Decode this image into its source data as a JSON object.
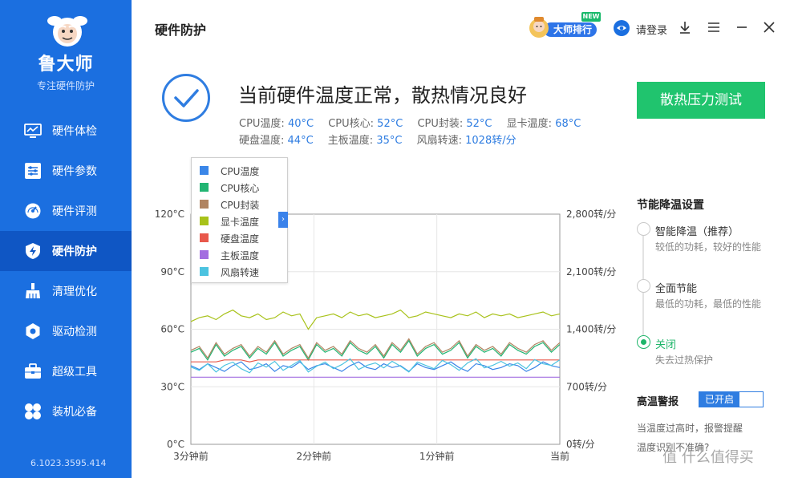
{
  "app": {
    "name": "鲁大师",
    "tagline": "专注硬件防护",
    "version": "6.1023.3595.414"
  },
  "sidebar": {
    "items": [
      {
        "label": "硬件体检",
        "icon": "monitor-icon"
      },
      {
        "label": "硬件参数",
        "icon": "sliders-icon"
      },
      {
        "label": "硬件评测",
        "icon": "speedometer-icon"
      },
      {
        "label": "硬件防护",
        "icon": "shield-bolt-icon",
        "active": true
      },
      {
        "label": "清理优化",
        "icon": "broom-icon"
      },
      {
        "label": "驱动检测",
        "icon": "gear-icon"
      },
      {
        "label": "超级工具",
        "icon": "toolbox-icon"
      },
      {
        "label": "装机必备",
        "icon": "apps-icon"
      }
    ]
  },
  "header": {
    "title": "硬件防护",
    "master_label": "大师排行",
    "new_badge": "NEW",
    "login_label": "请登录"
  },
  "status": {
    "headline": "当前硬件温度正常，散热情况良好",
    "row1": [
      {
        "label": "CPU温度:",
        "value": "40°C"
      },
      {
        "label": "CPU核心:",
        "value": "52°C"
      },
      {
        "label": "CPU封装:",
        "value": "52°C"
      },
      {
        "label": "显卡温度:",
        "value": "68°C"
      }
    ],
    "row2": [
      {
        "label": "硬盘温度:",
        "value": "44°C"
      },
      {
        "label": "主板温度:",
        "value": "35°C"
      },
      {
        "label": "风扇转速:",
        "value": "1028转/分"
      }
    ],
    "stress_button": "散热压力测试"
  },
  "legend": [
    {
      "label": "CPU温度",
      "color": "#3a86e8"
    },
    {
      "label": "CPU核心",
      "color": "#22b573"
    },
    {
      "label": "CPU封装",
      "color": "#b08461"
    },
    {
      "label": "显卡温度",
      "color": "#a8c21a"
    },
    {
      "label": "硬盘温度",
      "color": "#e8584b"
    },
    {
      "label": "主板温度",
      "color": "#a36ee0"
    },
    {
      "label": "风扇转速",
      "color": "#4cc3e0"
    }
  ],
  "chart_data": {
    "type": "line",
    "x_tick_labels": [
      "3分钟前",
      "2分钟前",
      "1分钟前",
      "当前"
    ],
    "y_left_ticks": [
      "0°C",
      "30°C",
      "60°C",
      "90°C",
      "120°C"
    ],
    "y_right_ticks": [
      "0转/分",
      "700转/分",
      "1,400转/分",
      "2,100转/分",
      "2,800转/分"
    ],
    "ylim_left": [
      0,
      120
    ],
    "ylim_right": [
      0,
      2800
    ],
    "grid": true,
    "series": [
      {
        "name": "显卡温度",
        "axis": "left",
        "color": "#a8c21a",
        "values": [
          64,
          66,
          67,
          65,
          68,
          70,
          67,
          66,
          68,
          65,
          66,
          69,
          67,
          68,
          60,
          66,
          67,
          68,
          66,
          69,
          67,
          68,
          66,
          67,
          68,
          70,
          66,
          67,
          69,
          68,
          67,
          66,
          68,
          67,
          69,
          66,
          68,
          67,
          68,
          66,
          67,
          68,
          69,
          67,
          68
        ]
      },
      {
        "name": "CPU核心",
        "axis": "left",
        "color": "#22b573",
        "values": [
          48,
          50,
          44,
          52,
          46,
          49,
          51,
          45,
          50,
          47,
          53,
          46,
          49,
          51,
          44,
          52,
          48,
          50,
          46,
          53,
          49,
          47,
          51,
          45,
          52,
          48,
          54,
          46,
          50,
          52,
          47,
          49,
          53,
          45,
          51,
          48,
          50,
          46,
          52,
          49,
          47,
          51,
          53,
          48,
          52
        ]
      },
      {
        "name": "CPU封装",
        "axis": "left",
        "color": "#b08461",
        "values": [
          49,
          51,
          45,
          53,
          47,
          50,
          52,
          46,
          51,
          48,
          54,
          47,
          50,
          52,
          45,
          53,
          49,
          51,
          47,
          54,
          50,
          48,
          52,
          46,
          53,
          49,
          55,
          47,
          51,
          53,
          48,
          50,
          54,
          46,
          52,
          49,
          51,
          47,
          53,
          50,
          48,
          52,
          54,
          49,
          53
        ]
      },
      {
        "name": "硬盘温度",
        "axis": "left",
        "color": "#e8584b",
        "values": [
          43,
          43,
          43,
          43,
          44,
          44,
          44,
          43,
          44,
          44,
          44,
          44,
          44,
          44,
          44,
          44,
          44,
          44,
          44,
          44,
          44,
          44,
          44,
          44,
          44,
          44,
          44,
          44,
          44,
          44,
          44,
          44,
          44,
          44,
          44,
          44,
          44,
          44,
          44,
          44,
          44,
          44,
          44,
          44,
          44
        ]
      },
      {
        "name": "CPU温度",
        "axis": "left",
        "color": "#3a86e8",
        "values": [
          41,
          39,
          42,
          40,
          38,
          41,
          43,
          39,
          40,
          42,
          38,
          41,
          40,
          43,
          39,
          41,
          42,
          40,
          38,
          41,
          43,
          40,
          39,
          42,
          40,
          41,
          38,
          42,
          40,
          39,
          41,
          43,
          40,
          38,
          42,
          41,
          39,
          40,
          42,
          41,
          38,
          40,
          43,
          41,
          40
        ]
      },
      {
        "name": "主板温度",
        "axis": "left",
        "color": "#a36ee0",
        "values": [
          35,
          35,
          35,
          35,
          35,
          35,
          35,
          35,
          35,
          35,
          35,
          35,
          35,
          35,
          35,
          35,
          35,
          35,
          35,
          35,
          35,
          35,
          35,
          35,
          35,
          35,
          35,
          35,
          35,
          35,
          35,
          35,
          35,
          35,
          35,
          35,
          35,
          35,
          35,
          35,
          35,
          35,
          35,
          35,
          35
        ]
      },
      {
        "name": "风扇转速",
        "axis": "right",
        "color": "#4cc3e0",
        "values": [
          940,
          900,
          980,
          880,
          960,
          1000,
          920,
          870,
          990,
          940,
          1010,
          900,
          960,
          1020,
          880,
          950,
          1000,
          920,
          970,
          1040,
          910,
          960,
          990,
          930,
          1010,
          950,
          880,
          1000,
          960,
          920,
          1020,
          970,
          900,
          990,
          1040,
          930,
          960,
          1010,
          950,
          990,
          920,
          1030,
          980,
          960,
          1028
        ]
      }
    ]
  },
  "settings": {
    "title": "节能降温设置",
    "options": [
      {
        "title": "智能降温（推荐）",
        "desc": "较低的功耗，较好的性能",
        "selected": false
      },
      {
        "title": "全面节能",
        "desc": "最低的功耗，最低的性能",
        "selected": false
      },
      {
        "title": "关闭",
        "desc": "失去过热保护",
        "selected": true
      }
    ],
    "alarm_label": "高温警报",
    "alarm_state": "已开启",
    "alarm_note1": "当温度过高时，报警提醒",
    "alarm_note2": "温度识别不准确?"
  },
  "watermark": "值 什么值得买"
}
